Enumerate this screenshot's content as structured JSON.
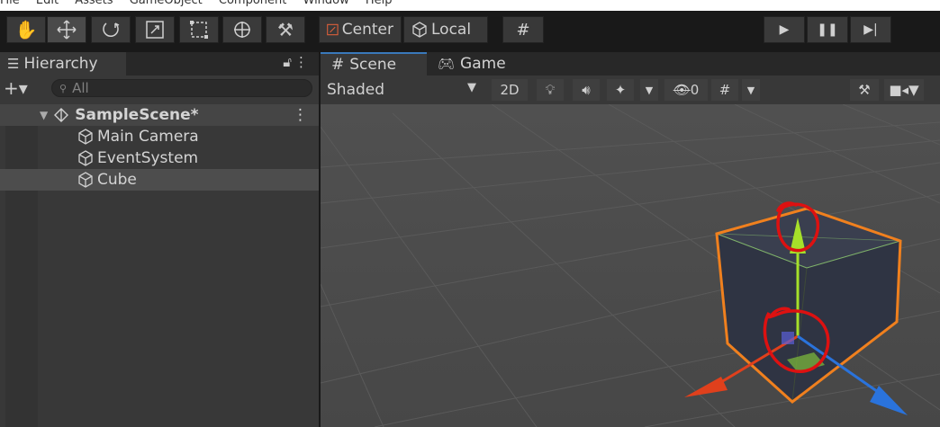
{
  "menubar": {
    "items": [
      "File",
      "Edit",
      "Assets",
      "GameObject",
      "Component",
      "Window",
      "Help"
    ]
  },
  "toolbar": {
    "tools": [
      "hand-tool",
      "move-tool",
      "rotate-tool",
      "scale-tool",
      "rect-tool",
      "transform-tool",
      "custom-tool"
    ],
    "pivot_label": "Center",
    "space_label": "Local"
  },
  "hierarchy": {
    "title": "Hierarchy",
    "search_placeholder": "All",
    "scene_name": "SampleScene*",
    "items": [
      "Main Camera",
      "EventSystem",
      "Cube"
    ],
    "selected_item": "Cube"
  },
  "scene": {
    "tabs": [
      "Scene",
      "Game"
    ],
    "shading_mode": "Shaded",
    "mode_2d": "2D",
    "hidden_count": "0"
  },
  "colors": {
    "annotation": "#dd1111",
    "accent_tab": "#3a79bb",
    "cube_outline": "#f0801e",
    "gizmo_y": "#a6e02a",
    "gizmo_x": "#e0401c",
    "gizmo_z": "#2a73dc"
  }
}
